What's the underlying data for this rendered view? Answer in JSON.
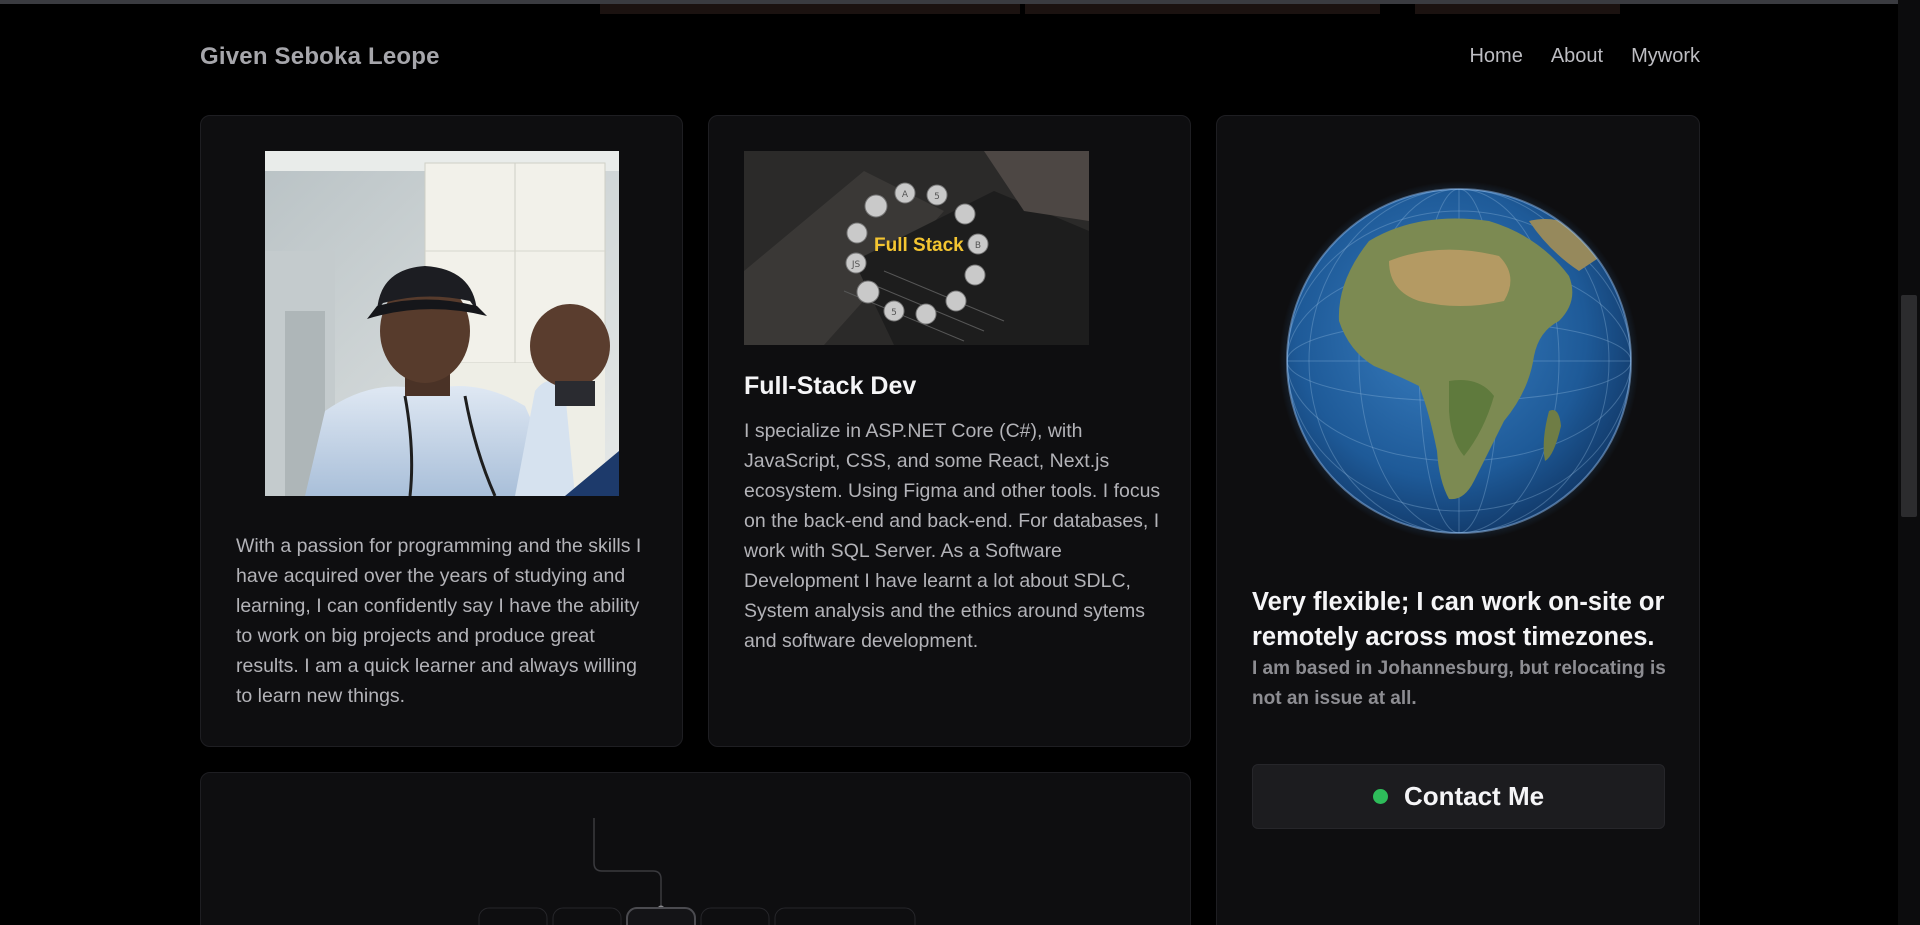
{
  "header": {
    "brand": "Given Seboka Leope",
    "nav": [
      {
        "label": "Home"
      },
      {
        "label": "About"
      },
      {
        "label": "Mywork"
      }
    ]
  },
  "about_card": {
    "photo_alt": "profile photo",
    "text": "With a passion for programming and the skills I have acquired over the years of studying and learning, I can confidently say I have the ability to work on big projects and produce great results. I am a quick learner and always willing to learn new things."
  },
  "skills_card": {
    "banner_text": "Full Stack",
    "title": "Full-Stack Dev",
    "text": "I specialize in ASP.NET Core (C#), with JavaScript, CSS, and some React, Next.js ecosystem. Using Figma and other tools. I focus on the back-end and back-end. For databases, I work with SQL Server. As a Software Development I have learnt a lot about SDLC, System analysis and the ethics around sytems and software development."
  },
  "location_card": {
    "title": "Very flexible; I can work on-site or remotely across most timezones.",
    "subtitle": "I am based in Johannesburg, but relocating is not an issue at all.",
    "contact_label": "Contact Me",
    "status_color": "#2ebc5a"
  },
  "colors": {
    "background": "#000000",
    "card": "#0e0e10",
    "accent_yellow": "#f4c531"
  }
}
